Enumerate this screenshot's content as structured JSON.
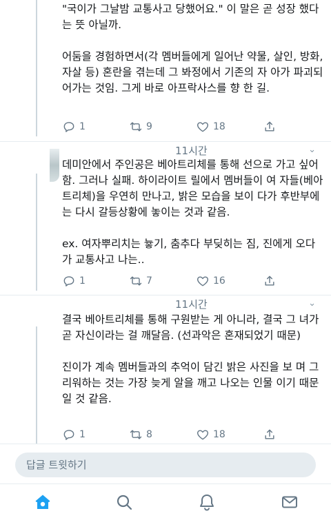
{
  "tweets": [
    {
      "paragraphs": [
        "\"국이가 그날밤 교통사고 당했어요.\" 이 말은 곧 성장 했다는 뜻 아닐까.",
        "어둠을 경험하면서(각 멤버들에게 일어난 약물, 살인, 방화, 자살 등) 혼란을 겪는데 그 봐정에서 기존의 자 아가 파괴되어가는 것임. 그게 바로 아프락사스를 향 한 길."
      ],
      "replies": "1",
      "retweets": "9",
      "likes": "18"
    },
    {
      "time": "11시간",
      "paragraphs": [
        "데미안에서 주인공은 베아트리체를 통해 선으로 가고 싶어 함. 그러나 실패. 하이라이트 릴에서 멤버들이 여 자들(베아트리체)을 우연히 만나고, 밝은 모습을 보이 다가 후반부에는 다시 갈등상황에 놓이는 것과 같음.",
        "ex. 여자뿌리치는 늏기, 춤추다 부딪히는 짐, 진에게 오다가 교통사고 나는.."
      ],
      "replies": "1",
      "retweets": "7",
      "likes": "16"
    },
    {
      "time": "11시간",
      "paragraphs": [
        "결국 베아트리체를 통해 구원받는 게 아니라, 결국 그 녀가 곧 자신이라는 걸 깨달음. (선과악은 혼재되었기 때문)",
        "진이가 계속 멤버들과의 추억이 담긴 밝은 사진을 보 며 그리워하는 것는 가장 늦게 알을 깨고 나오는 인물 이기 때문일 것 같음."
      ],
      "replies": "1",
      "retweets": "8",
      "likes": "18"
    }
  ],
  "reply_bar": {
    "placeholder": "답글 트윗하기"
  },
  "tabbar": {
    "items": [
      "home-icon",
      "search-icon",
      "notifications-icon",
      "messages-icon"
    ],
    "active": "home",
    "accent": "#1da1f2",
    "inactive_color": "#657786"
  }
}
